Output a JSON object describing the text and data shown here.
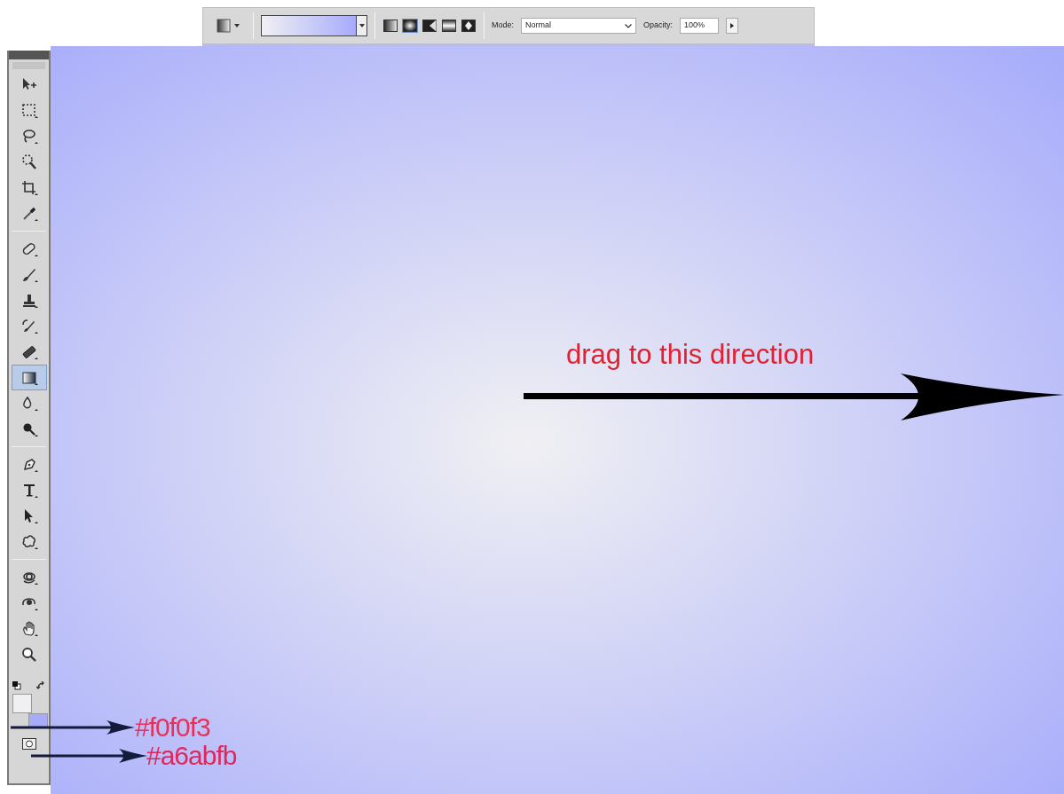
{
  "options_bar": {
    "gradient_types": [
      {
        "kind": "linear",
        "selected": false
      },
      {
        "kind": "radial",
        "selected": true
      },
      {
        "kind": "angle",
        "selected": false
      },
      {
        "kind": "reflected",
        "selected": false
      },
      {
        "kind": "diamond",
        "selected": false
      }
    ],
    "mode": {
      "label": "Mode:",
      "value": "Normal"
    },
    "opacity": {
      "label": "Opacity:",
      "value": "100%"
    }
  },
  "toolbar": {
    "groups": [
      [
        {
          "kind": "move",
          "selected": false
        },
        {
          "kind": "marquee",
          "selected": false
        },
        {
          "kind": "lasso",
          "selected": false
        },
        {
          "kind": "quickselect",
          "selected": false
        },
        {
          "kind": "crop",
          "selected": false
        },
        {
          "kind": "eyedropper",
          "selected": false
        }
      ],
      [
        {
          "kind": "healing",
          "selected": false
        },
        {
          "kind": "brush",
          "selected": false
        },
        {
          "kind": "stamp",
          "selected": false
        },
        {
          "kind": "historybrush",
          "selected": false
        },
        {
          "kind": "eraser",
          "selected": false
        },
        {
          "kind": "gradient",
          "selected": true
        },
        {
          "kind": "blur",
          "selected": false
        },
        {
          "kind": "dodge",
          "selected": false
        }
      ],
      [
        {
          "kind": "pen",
          "selected": false
        },
        {
          "kind": "type",
          "selected": false
        },
        {
          "kind": "pathselect",
          "selected": false
        },
        {
          "kind": "shape",
          "selected": false
        }
      ],
      [
        {
          "kind": "rotate3d",
          "selected": false
        },
        {
          "kind": "orbit3d",
          "selected": false
        },
        {
          "kind": "hand",
          "selected": false
        },
        {
          "kind": "zoom",
          "selected": false
        }
      ]
    ],
    "swatches": [
      {
        "kind": "foreground",
        "color": "#f0f0f3"
      },
      {
        "kind": "background",
        "color": "#a6abfb"
      }
    ]
  },
  "annotations": [
    {
      "kind": "direction",
      "text": "drag to this direction"
    },
    {
      "kind": "color_label",
      "text": "#f0f0f3"
    },
    {
      "kind": "color_label",
      "text": "#a6abfb"
    }
  ]
}
